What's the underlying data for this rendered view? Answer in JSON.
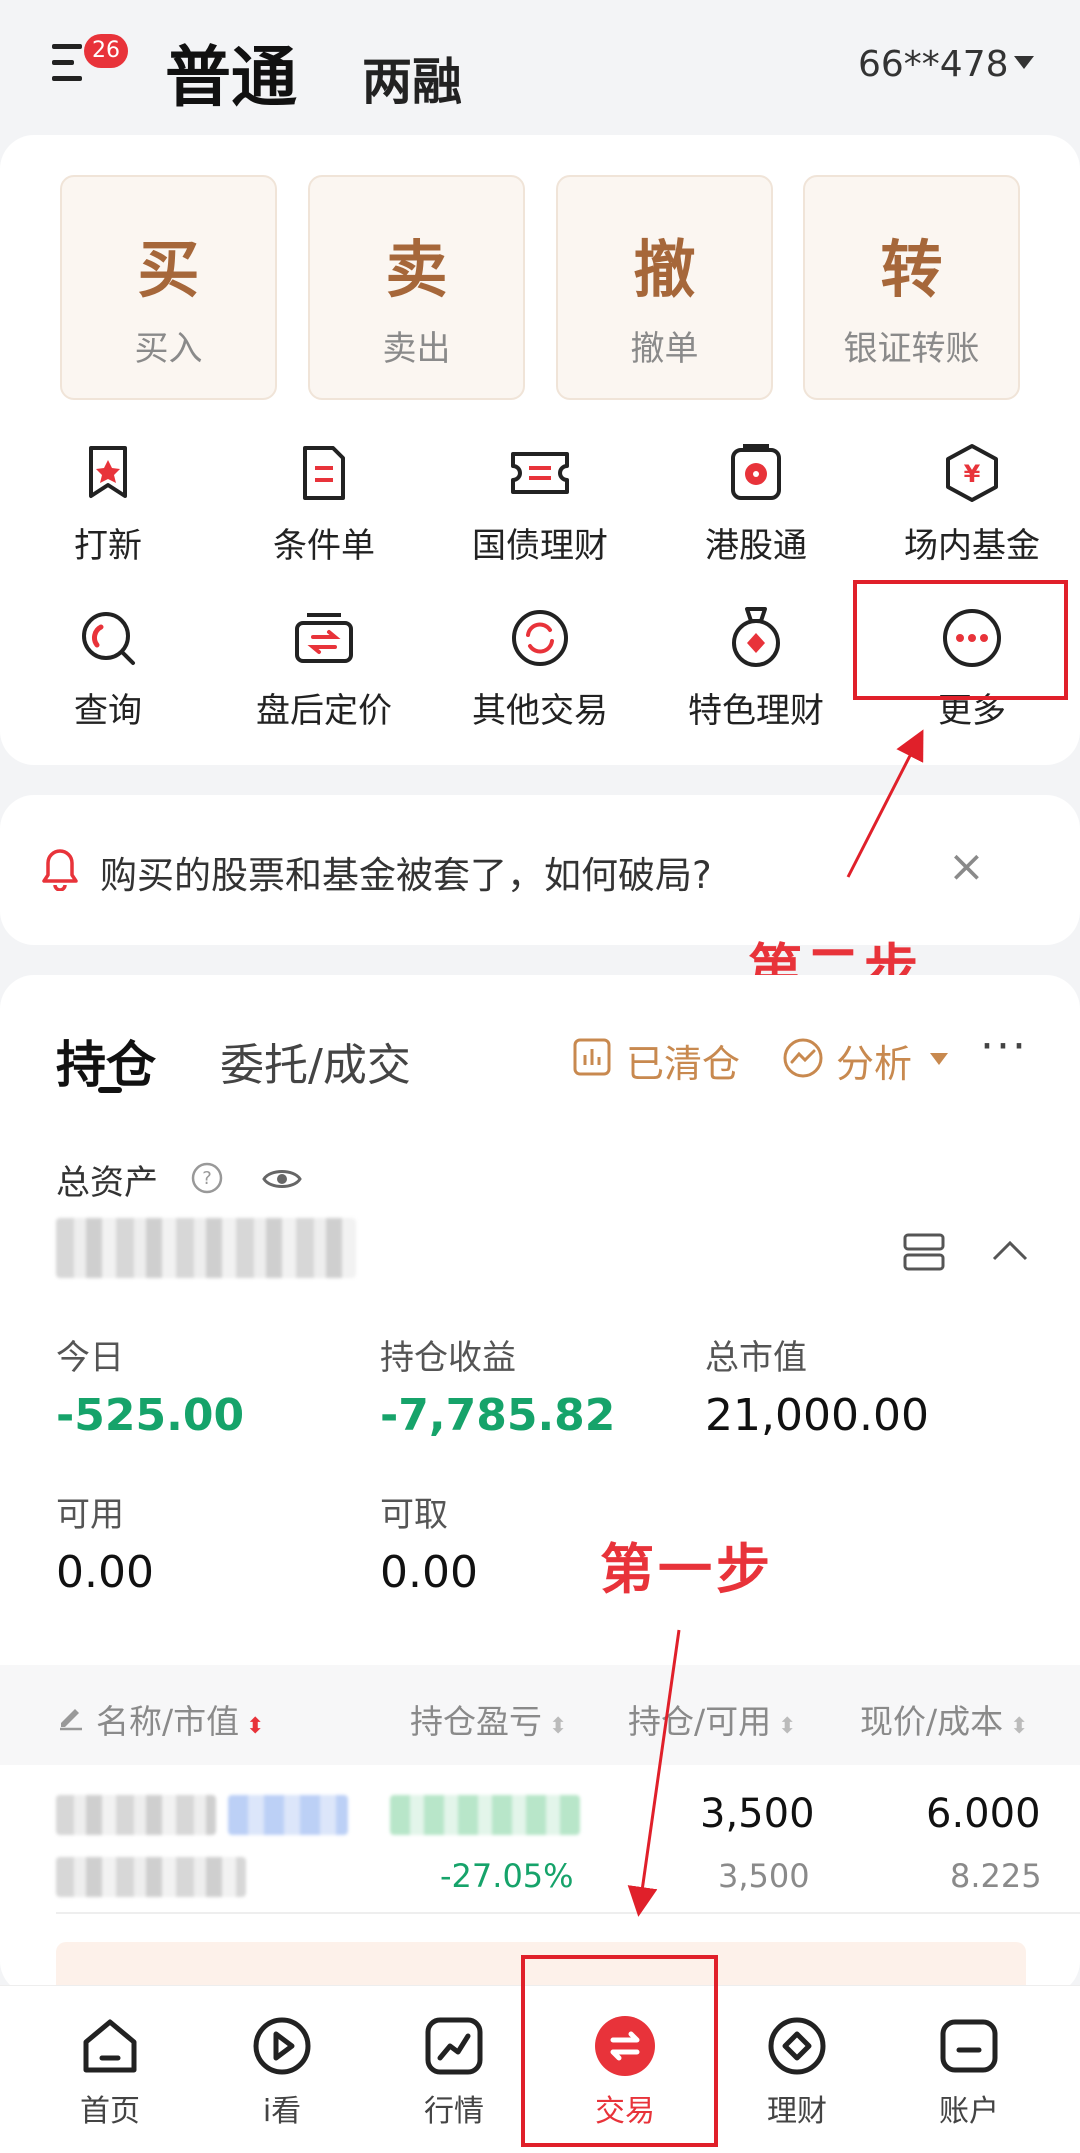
{
  "header": {
    "badge_count": "26",
    "tab_active": "普通",
    "tab_other": "两融",
    "account": "66**478"
  },
  "trade_buttons": [
    {
      "big": "买",
      "small": "买入"
    },
    {
      "big": "卖",
      "small": "卖出"
    },
    {
      "big": "撤",
      "small": "撤单"
    },
    {
      "big": "转",
      "small": "银证转账"
    }
  ],
  "grid": [
    {
      "label": "打新",
      "icon": "star-bookmark-icon"
    },
    {
      "label": "条件单",
      "icon": "condition-order-icon"
    },
    {
      "label": "国债理财",
      "icon": "ticket-icon"
    },
    {
      "label": "港股通",
      "icon": "hk-flower-icon"
    },
    {
      "label": "场内基金",
      "icon": "yen-hexagon-icon"
    },
    {
      "label": "查询",
      "icon": "search-icon"
    },
    {
      "label": "盘后定价",
      "icon": "swap-price-icon"
    },
    {
      "label": "其他交易",
      "icon": "refresh-icon"
    },
    {
      "label": "特色理财",
      "icon": "medal-icon"
    },
    {
      "label": "更多",
      "icon": "more-dots-icon"
    }
  ],
  "notice": {
    "text": "购买的股票和基金被套了，如何破局?",
    "close": "×"
  },
  "position": {
    "tab_active": "持仓",
    "tab_other": "委托/成交",
    "cleared": "已清仓",
    "analysis": "分析",
    "more": "···",
    "total_assets_label": "总资产",
    "stats": [
      {
        "label": "今日",
        "value": "-525.00",
        "negative": true
      },
      {
        "label": "持仓收益",
        "value": "-7,785.82",
        "negative": true
      },
      {
        "label": "总市值",
        "value": "21,000.00",
        "negative": false
      },
      {
        "label": "可用",
        "value": "0.00",
        "negative": false
      },
      {
        "label": "可取",
        "value": "0.00",
        "negative": false
      }
    ],
    "table_headers": [
      "名称/市值",
      "持仓盈亏",
      "持仓/可用",
      "现价/成本"
    ],
    "row": {
      "pnl_pct": "-27.05%",
      "qty": "3,500",
      "avail": "3,500",
      "price": "6.000",
      "cost": "8.225"
    }
  },
  "nav": [
    {
      "label": "首页",
      "icon": "home-icon"
    },
    {
      "label": "i看",
      "icon": "play-icon"
    },
    {
      "label": "行情",
      "icon": "chart-icon"
    },
    {
      "label": "交易",
      "icon": "trade-icon"
    },
    {
      "label": "理财",
      "icon": "diamond-icon"
    },
    {
      "label": "账户",
      "icon": "account-icon"
    }
  ],
  "annotations": {
    "step1": "第一步",
    "step2": "第二步"
  },
  "colors": {
    "accent": "#e8333a",
    "brown": "#a6673a",
    "loss": "#16a36a"
  }
}
